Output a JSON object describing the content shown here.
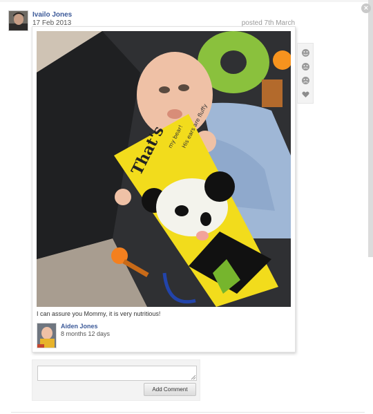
{
  "post": {
    "author_name": "Ivailo Jones",
    "date": "17 Feb 2013",
    "posted_label": "posted 7th March",
    "caption": "I can assure you Mommy, it is very nutritious!"
  },
  "photo": {
    "book_title": "That's",
    "book_subtitle_1": "my bear!",
    "book_subtitle_2": "His ears are fluffy"
  },
  "child": {
    "name": "Aiden Jones",
    "age": "8 months 12 days"
  },
  "reactions": [
    {
      "name": "happy-icon"
    },
    {
      "name": "neutral-icon"
    },
    {
      "name": "sad-icon"
    },
    {
      "name": "heart-icon"
    }
  ],
  "comment": {
    "placeholder": "",
    "button_label": "Add Comment"
  },
  "controls": {
    "close_icon": "close-icon"
  }
}
